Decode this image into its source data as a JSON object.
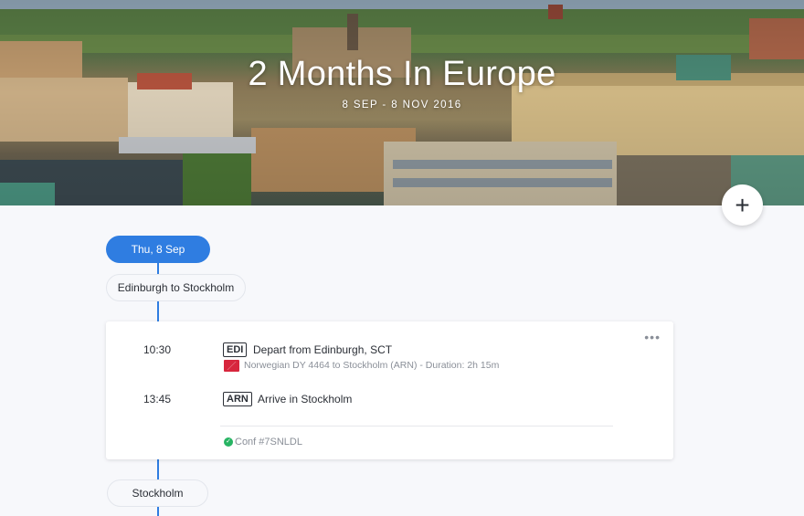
{
  "trip": {
    "title": "2 Months In Europe",
    "dates": "8 SEP - 8 NOV 2016"
  },
  "actions": {
    "add_symbol": "+"
  },
  "timeline": {
    "date_label": "Thu, 8 Sep",
    "segment_label": "Edinburgh to Stockholm",
    "next_place_label": "Stockholm"
  },
  "flight_card": {
    "menu_symbol": "•••",
    "departure": {
      "time": "10:30",
      "airport_code": "EDI",
      "title": "Depart from Edinburgh, SCT",
      "details": "Norwegian DY 4464 to Stockholm (ARN) - Duration: 2h 15m"
    },
    "arrival": {
      "time": "13:45",
      "airport_code": "ARN",
      "title": "Arrive in Stockholm"
    },
    "confirmation": "Conf #7SNLDL"
  },
  "colors": {
    "accent": "#2f7de1",
    "confirmed": "#28b463",
    "airline_logo": "#d7263d"
  }
}
